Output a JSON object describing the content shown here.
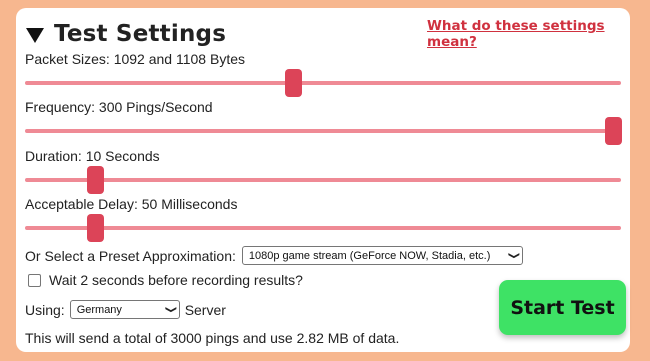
{
  "header": {
    "title": "Test Settings",
    "help_link": "What do these settings mean?"
  },
  "sliders": [
    {
      "label": "Packet Sizes: 1092 and 1108 Bytes",
      "level": 0.42
    },
    {
      "label": "Frequency: 300 Pings/Second",
      "level": 1.0
    },
    {
      "label": "Duration: 10 Seconds",
      "level": 0.06
    },
    {
      "label": "Acceptable Delay: 50 Milliseconds",
      "level": 0.06
    }
  ],
  "preset": {
    "label": "Or Select a Preset Approximation:",
    "selected": "1080p game stream (GeForce NOW, Stadia, etc.)"
  },
  "wait": {
    "label": "Wait 2 seconds before recording results?",
    "checked": false
  },
  "server": {
    "prefix": "Using:",
    "selected": "Germany",
    "suffix": "Server"
  },
  "start_button": "Start Test",
  "summary": "This will send a total of 3000 pings and use 2.82 MB of data.",
  "colors": {
    "background": "#f7b78f",
    "accent": "#dc4458",
    "track": "#ef8a95",
    "start_button": "#3ee265",
    "link": "#d0313f"
  }
}
